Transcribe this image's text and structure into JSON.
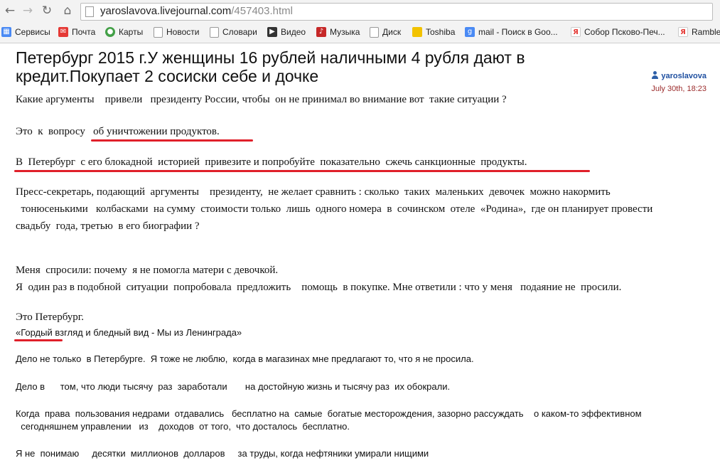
{
  "browser": {
    "url_host": "yaroslavova.livejournal.com",
    "url_path": "/457403.html",
    "bookmarks": [
      {
        "label": "Сервисы",
        "icon": "apps-grid-icon",
        "color": "#4a8af4"
      },
      {
        "label": "Почта",
        "icon": "mail-icon",
        "color": "#e53935"
      },
      {
        "label": "Карты",
        "icon": "maps-icon",
        "color": "#43a047"
      },
      {
        "label": "Новости",
        "icon": "news-icon",
        "color": "#8c8c8c"
      },
      {
        "label": "Словари",
        "icon": "dictionary-icon",
        "color": "#8c8c8c"
      },
      {
        "label": "Видео",
        "icon": "video-icon",
        "color": "#333333"
      },
      {
        "label": "Музыка",
        "icon": "music-icon",
        "color": "#c62828"
      },
      {
        "label": "Диск",
        "icon": "disk-icon",
        "color": "#8c8c8c"
      },
      {
        "label": "Toshiba",
        "icon": "folder-icon",
        "color": "#f2c200"
      },
      {
        "label": "mail - Поиск в Goo...",
        "icon": "google-icon",
        "color": "#4a8af4"
      },
      {
        "label": "Собор Псково-Печ...",
        "icon": "yandex-icon",
        "color": "#ffffff"
      },
      {
        "label": "Rambler",
        "icon": "yandex-icon",
        "color": "#ffffff"
      }
    ]
  },
  "post": {
    "title": "Петербург 2015 г.У женщины 16 рублей наличными 4 рубля дают в\nкредит.Покупает 2 сосиски себе и дочке",
    "author": "yaroslavova",
    "date": "July 30th, 18:23",
    "p1": "Какие аргументы    привели   президенту России, чтобы  он не принимал во внимание вот  такие ситуации ?",
    "p2": "Это  к  вопросу   об уничтожении продуктов.",
    "p3": "В  Петербург  с его блокадной  историей  привезите и попробуйте  показательно  сжечь санкционные  продукты.",
    "p4_1": "Пресс-секретарь, подающий  аргументы    президенту,  не желает сравнить : сколько  таких  маленьких  девочек  можно накормить",
    "p4_2": "  тонюсенькими   колбасками  на сумму  стоимости только  лишь  одного номера  в  сочинском  отеле  «Родина»,  где он планирует провести",
    "p4_3": "свадьбу  года, третью  в его биографии ?",
    "p5_1": "Меня  спросили: почему  я не помогла матери с девочкой.",
    "p5_2": "Я  один раз в подобной  ситуации  попробовала  предложить    помощь  в покупке. Мне ответили : что у меня   подаяние не  просили.",
    "p6": "Это Петербург.",
    "quote": "«Гордый взгляд и бледный вид - Мы из Ленинграда»",
    "s1": "Дело не только  в Петербурге.  Я тоже не люблю,  когда в магазинах мне предлагают то, что я не просила.",
    "s2": "Дело в      том, что люди тысячу  раз  заработали       на достойную жизнь и тысячу раз  их обокрали.",
    "s3_1": "Когда  права  пользования недрами  отдавались   бесплатно на  самые  богатые месторождения, зазорно рассуждать    о каком-то эффективном",
    "s3_2": "  сегодняшнем управлении   из    доходов  от того,  что досталось  бесплатно.",
    "s4": "Я не  понимаю     десятки  миллионов  долларов     за труды, когда нефтяники умирали нищими"
  },
  "colors": {
    "underline": "#e0202a",
    "author_link": "#1e4fa0",
    "date": "#9b2b2b"
  }
}
